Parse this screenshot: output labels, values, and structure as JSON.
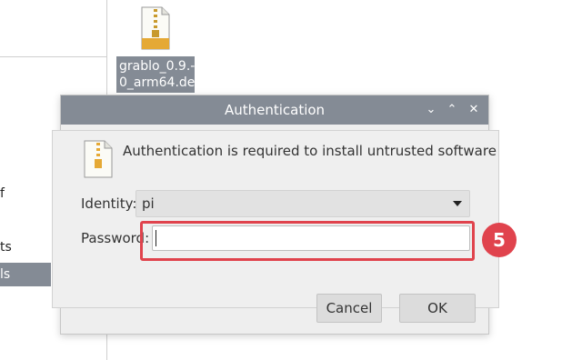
{
  "file_manager": {
    "sidebar_items": [
      {
        "label": "f"
      },
      {
        "label": "ts"
      },
      {
        "label": "ls"
      }
    ],
    "desktop_file": {
      "label_line1": "grablo_0.9.-",
      "label_line2": "0_arm64.de-",
      "icon": "archive-file-icon"
    }
  },
  "dialog": {
    "title": "Authentication",
    "window_controls": {
      "minimize": "⌄",
      "maximize": "⌃",
      "close": "✕"
    },
    "message": "Authentication is required to install untrusted software",
    "identity_label": "Identity:",
    "identity_value": "pi",
    "password_label": "Password:",
    "password_value": "",
    "cancel_label": "Cancel",
    "ok_label": "OK"
  },
  "annotation": {
    "step_number": "5",
    "color": "#e0434d"
  },
  "colors": {
    "titlebar": "#848b95",
    "dialog_bg": "#eeeeee",
    "selection": "#848b95"
  }
}
